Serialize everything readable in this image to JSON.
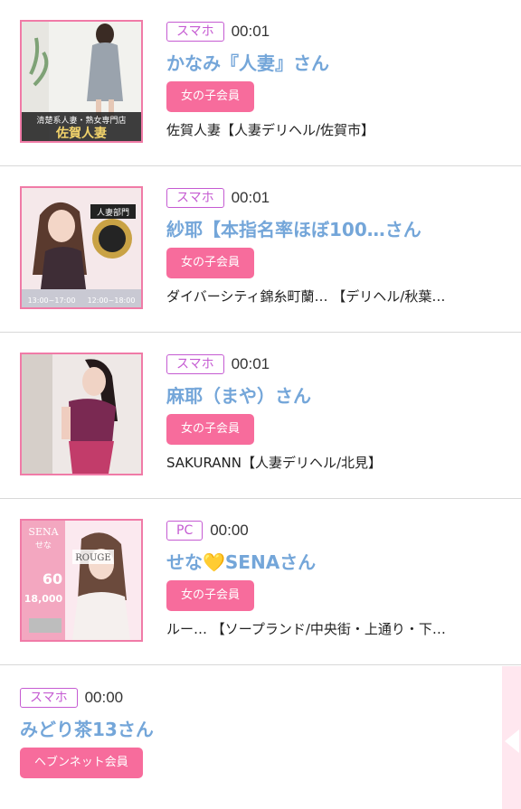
{
  "items": [
    {
      "device": "スマホ",
      "time": "00:01",
      "name": "かなみ『人妻』さん",
      "badge": "女の子会員",
      "shop": "佐賀人妻【人妻デリヘル/佐賀市】",
      "thumb_text_1": "清楚系人妻・熟女専門店",
      "thumb_text_2": "佐賀人妻"
    },
    {
      "device": "スマホ",
      "time": "00:01",
      "name": "紗耶【本指名率ほぼ100…さん",
      "badge": "女の子会員",
      "shop": "ダイバーシティ錦糸町蘭… 【デリヘル/秋葉…",
      "thumb_text_1": "人妻部門",
      "thumb_text_2": "13:00~17:00",
      "thumb_text_3": "12:00~18:00"
    },
    {
      "device": "スマホ",
      "time": "00:01",
      "name": "麻耶（まや）さん",
      "badge": "女の子会員",
      "shop": "SAKURANN【人妻デリヘル/北見】"
    },
    {
      "device": "PC",
      "time": "00:00",
      "name": "せな💛SENAさん",
      "badge": "女の子会員",
      "shop": "ルー… 【ソープランド/中央街・上通り・下…",
      "thumb_text_1": "SENA",
      "thumb_text_2": "せな",
      "thumb_text_3": "ROUGE",
      "thumb_text_4": "60",
      "thumb_text_5": "18,000"
    },
    {
      "device": "スマホ",
      "time": "00:00",
      "name": "みどり茶13さん",
      "badge": "ヘブンネット会員"
    }
  ],
  "colors": {
    "accent_pink": "#f76c9c",
    "device_purple": "#c55bd2",
    "name_blue": "#74a6d9"
  }
}
